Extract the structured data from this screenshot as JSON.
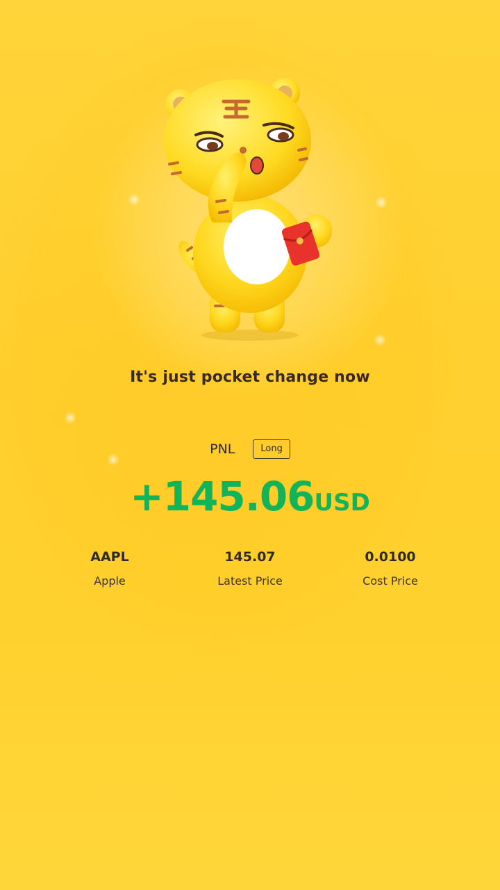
{
  "tagline": "It's just pocket change now",
  "pnl": {
    "label": "PNL",
    "direction": "Long",
    "amount": "+145.06",
    "currency": "USD",
    "amount_color": "#12B45A"
  },
  "stats": [
    {
      "value": "AAPL",
      "label": "Apple"
    },
    {
      "value": "145.07",
      "label": "Latest Price"
    },
    {
      "value": "0.0100",
      "label": "Cost Price"
    }
  ],
  "mascot": {
    "icon": "tiger-mascot-icon",
    "holding": "red-envelope-icon"
  },
  "colors": {
    "background": "#FFD232",
    "text": "#2E2A26"
  }
}
